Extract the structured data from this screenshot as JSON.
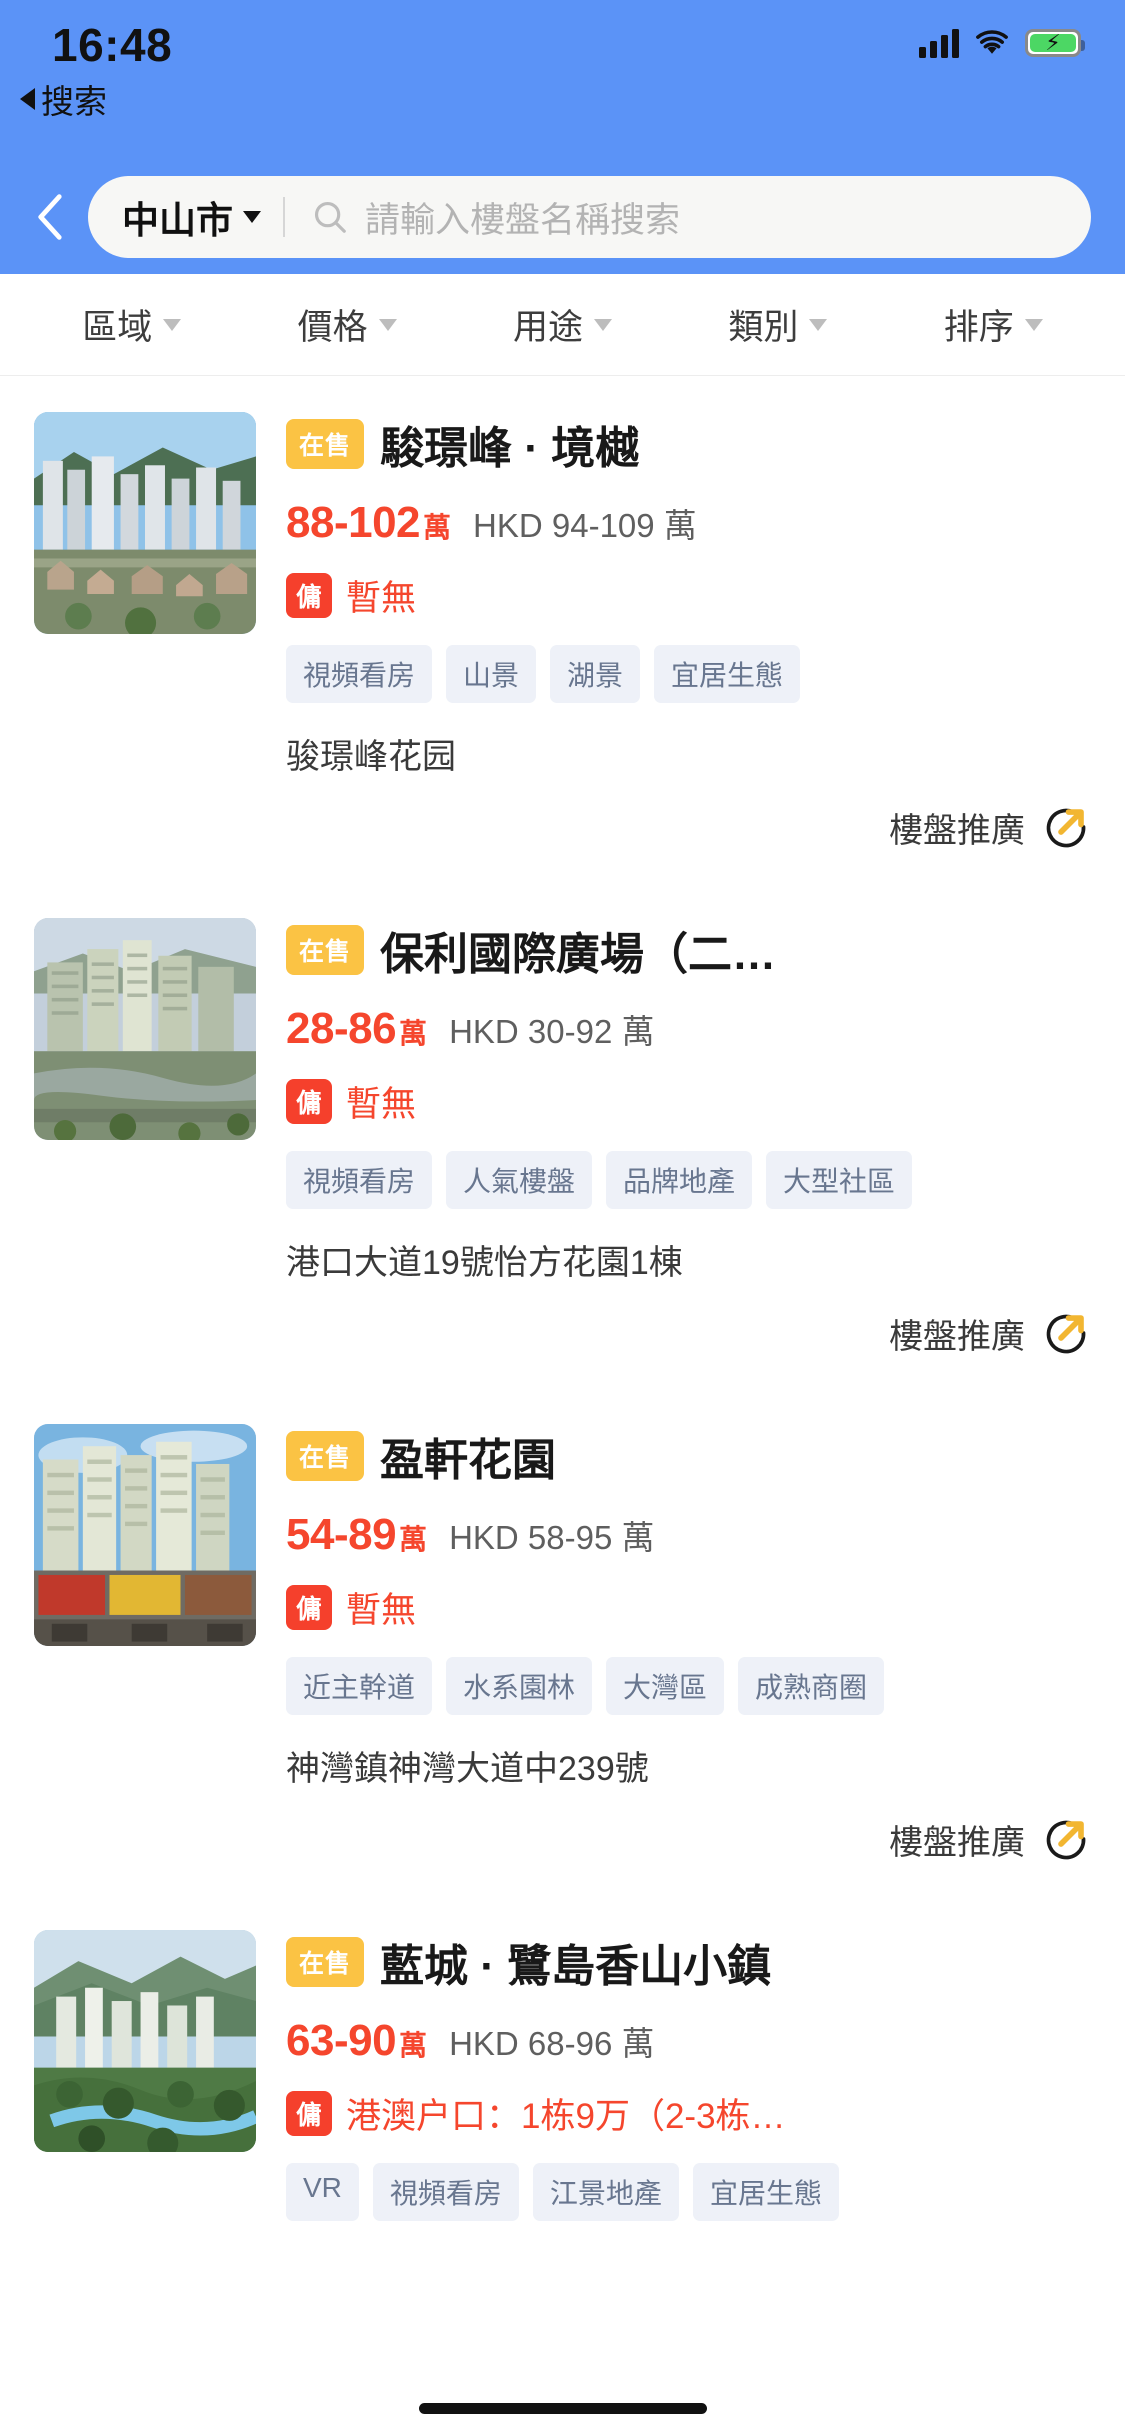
{
  "status_bar": {
    "time": "16:48",
    "back_app_label": "搜索",
    "signal_icon": "signal-bars-icon",
    "wifi_icon": "wifi-icon",
    "battery_icon": "battery-charging-icon",
    "battery_color": "#4cd764"
  },
  "header": {
    "back_icon": "chevron-left-icon",
    "city": "中山市",
    "city_caret_icon": "caret-down-icon",
    "search_icon": "search-icon",
    "search_placeholder": "請輸入樓盤名稱搜索",
    "search_value": "",
    "background_color": "#5b93f7"
  },
  "filters": [
    {
      "label": "區域",
      "icon": "caret-down-icon"
    },
    {
      "label": "價格",
      "icon": "caret-down-icon"
    },
    {
      "label": "用途",
      "icon": "caret-down-icon"
    },
    {
      "label": "類別",
      "icon": "caret-down-icon"
    },
    {
      "label": "排序",
      "icon": "caret-down-icon"
    }
  ],
  "promo": {
    "label": "樓盤推廣",
    "icon": "promotion-arrow-circle-icon",
    "accent_color": "#f2b631"
  },
  "listings": [
    {
      "status_badge": "在售",
      "title": "駿璟峰 · 境樾",
      "price_main": "88-102",
      "price_unit": "萬",
      "price_alt": "HKD 94-109 萬",
      "commission_badge": "傭",
      "commission_text": "暫無",
      "tags": [
        "視頻看房",
        "山景",
        "湖景",
        "宜居生態"
      ],
      "address": "骏璟峰花园",
      "has_promo_row": true,
      "thumb": "aerial-residential-towers-photo"
    },
    {
      "status_badge": "在售",
      "title": "保利國際廣場（二…",
      "price_main": "28-86",
      "price_unit": "萬",
      "price_alt": "HKD 30-92 萬",
      "commission_badge": "傭",
      "commission_text": "暫無",
      "tags": [
        "視頻看房",
        "人氣樓盤",
        "品牌地產",
        "大型社區"
      ],
      "address": "港口大道19號怡方花園1棟",
      "has_promo_row": true,
      "thumb": "office-towers-rendering-photo"
    },
    {
      "status_badge": "在售",
      "title": "盈軒花園",
      "price_main": "54-89",
      "price_unit": "萬",
      "price_alt": "HKD 58-95 萬",
      "commission_badge": "傭",
      "commission_text": "暫無",
      "tags": [
        "近主幹道",
        "水系園林",
        "大灣區",
        "成熟商圈"
      ],
      "address": "神灣鎮神灣大道中239號",
      "has_promo_row": true,
      "thumb": "mall-and-apartment-blocks-photo"
    },
    {
      "status_badge": "在售",
      "title": "藍城 · 鷺島香山小鎮",
      "price_main": "63-90",
      "price_unit": "萬",
      "price_alt": "HKD 68-96 萬",
      "commission_badge": "傭",
      "commission_text": "港澳户口：1栋9万（2-3栋…",
      "tags": [
        "VR",
        "視頻看房",
        "江景地產",
        "宜居生態"
      ],
      "address": "",
      "has_promo_row": false,
      "thumb": "green-hillside-residences-photo"
    }
  ],
  "home_indicator": "home-indicator"
}
